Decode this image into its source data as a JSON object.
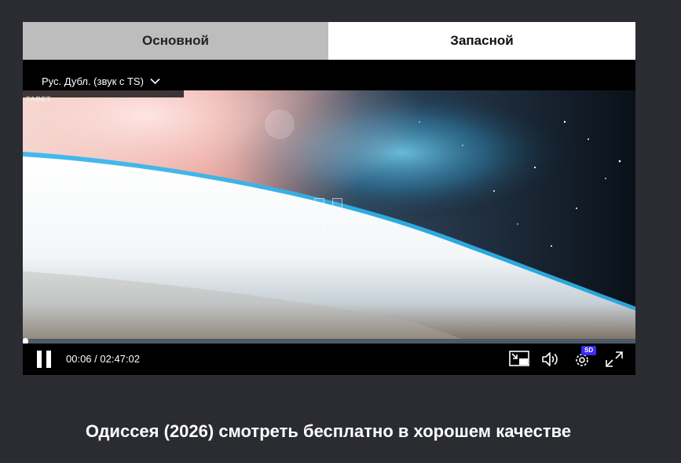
{
  "player": {
    "tabs": [
      {
        "label": "Основной",
        "active": false
      },
      {
        "label": "Запасной",
        "active": true
      }
    ],
    "audio_track": "Рус. Дубл. (звук с TS)",
    "watermark": "TABET",
    "state": "paused",
    "time_display": "00:06 / 02:47:02",
    "progress": 0.0006,
    "quality_badge": "SD",
    "icons": [
      "pause-icon",
      "picture-in-picture-icon",
      "volume-icon",
      "settings-gear-icon",
      "fullscreen-icon",
      "chevron-down-icon"
    ],
    "colors": {
      "tab_active_bg": "#ffffff",
      "tab_inactive_bg": "#bdbdbd",
      "controls_bg": "#000000",
      "quality_badge_bg": "#3a2df0",
      "page_bg": "#2b2c31"
    }
  },
  "page": {
    "title": "Одиссея (2026) смотреть бесплатно в хорошем качестве"
  }
}
